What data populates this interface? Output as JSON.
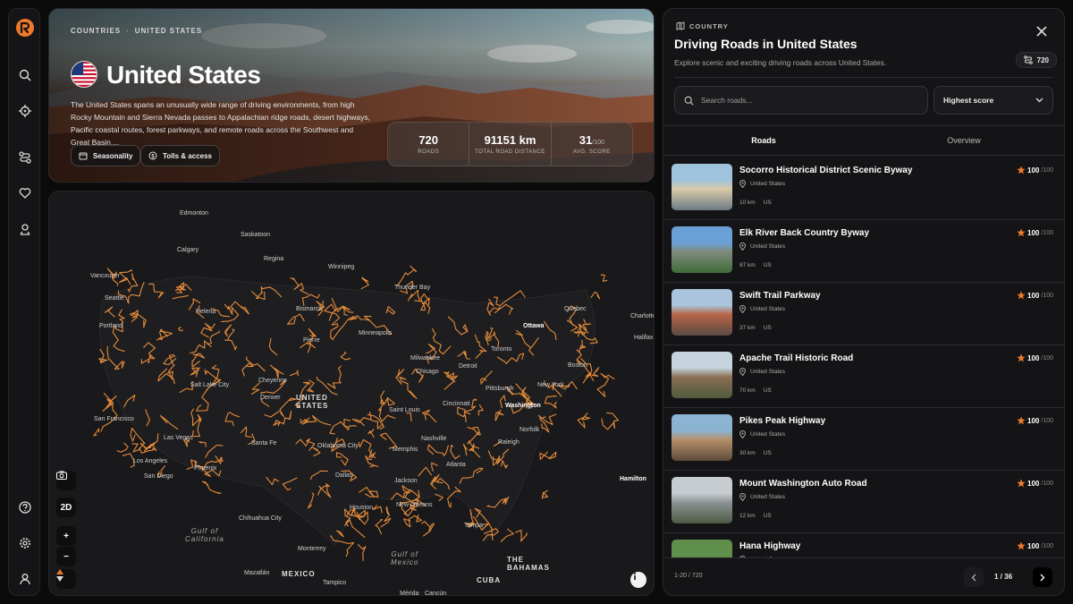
{
  "nav": {
    "items": [
      "search-icon",
      "target-icon",
      "routes-icon",
      "heart-icon",
      "profile-location-icon"
    ],
    "bottom": [
      "help-icon",
      "gear-icon",
      "user-icon"
    ]
  },
  "hero": {
    "breadcrumb": [
      "COUNTRIES",
      "UNITED STATES"
    ],
    "title": "United States",
    "description": "The United States spans an unusually wide range of driving environments, from high Rocky Mountain and Sierra Nevada passes to Appalachian ridge roads, desert highways, Pacific coastal routes, forest parkways, and remote roads across the Southwest and Great Basin....",
    "chips": [
      "Seasonality",
      "Tolls & access"
    ],
    "stats": [
      {
        "value": "720",
        "suffix": "",
        "label": "ROADS"
      },
      {
        "value": "91151 km",
        "suffix": "",
        "label": "TOTAL ROAD DISTANCE"
      },
      {
        "value": "31",
        "suffix": "/100",
        "label": "AVG. SCORE"
      }
    ]
  },
  "map": {
    "labels": {
      "edmonton": "Edmonton",
      "saskatoon": "Saskatoon",
      "calgary": "Calgary",
      "regina": "Regina",
      "winnipeg": "Winnipeg",
      "thunder_bay": "Thunder Bay",
      "vancouver": "Vancouver",
      "seattle": "Seattle",
      "helena": "Helena",
      "bismarck": "Bismarck",
      "quebec": "Quebec",
      "ottawa": "Ottawa",
      "charlotte": "Charlotte",
      "halifax": "Halifax",
      "portland": "Portland",
      "minneapolis": "Minneapolis",
      "pierre": "Pierre",
      "toronto": "Toronto",
      "milwaukee": "Milwaukee",
      "boston": "Boston",
      "detroit": "Detroit",
      "chicago": "Chicago",
      "cheyenne": "Cheyenne",
      "salt_lake": "Salt Lake City",
      "denver": "Denver",
      "pittsburgh": "Pittsburgh",
      "new_york": "New York",
      "united_states": "UNITED\nSTATES",
      "cincinnati": "Cincinnati",
      "washington": "Washington",
      "san_francisco": "San Francisco",
      "saint_louis": "Saint Louis",
      "las_vegas": "Las Vegas",
      "nashville": "Nashville",
      "norfolk": "Norfolk",
      "santa_fe": "Santa Fe",
      "oklahoma": "Oklahoma City",
      "memphis": "Memphis",
      "raleigh": "Raleigh",
      "los_angeles": "Los Angeles",
      "phoenix": "Phoenix",
      "atlanta": "Atlanta",
      "san_diego": "San Diego",
      "dallas": "Dallas",
      "jackson": "Jackson",
      "hamilton": "Hamilton",
      "houston": "Houston",
      "new_orleans": "New Orleans",
      "chihuahua": "Chihuahua City",
      "tampa": "Tampa",
      "gulf_california": "Gulf of\nCalifornia",
      "monterrey": "Monterrey",
      "gulf_mexico": "Gulf of\nMexico",
      "the_bahamas": "THE\nBAHAMAS",
      "mazatlan": "Mazatlán",
      "mexico": "MEXICO",
      "cuba": "CUBA",
      "tampico": "Tampico",
      "merida": "Mérida",
      "cancun": "Cancún"
    },
    "controls": {
      "mode": "2D",
      "plus": "+",
      "minus": "−"
    }
  },
  "panel": {
    "kicker": "COUNTRY",
    "title": "Driving Roads in United States",
    "subtitle": "Explore scenic and exciting driving roads across United States.",
    "count": "720",
    "search_placeholder": "Search roads...",
    "sort_value": "Highest score",
    "tabs": [
      "Roads",
      "Overview"
    ],
    "roads": [
      {
        "name": "Socorro Historical District Scenic Byway",
        "country": "United States",
        "distance": "10 km",
        "code": "US",
        "score": "100",
        "max": "/100",
        "colors": [
          "#9fc3dc",
          "#d8c9a8",
          "#6b7a84"
        ]
      },
      {
        "name": "Elk River Back Country Byway",
        "country": "United States",
        "distance": "87 km",
        "code": "US",
        "score": "100",
        "max": "/100",
        "colors": [
          "#6aa0d6",
          "#7f8b7c",
          "#3f6b3a"
        ]
      },
      {
        "name": "Swift Trail Parkway",
        "country": "United States",
        "distance": "37 km",
        "code": "US",
        "score": "100",
        "max": "/100",
        "colors": [
          "#a9c4dc",
          "#b76445",
          "#5a4a45"
        ]
      },
      {
        "name": "Apache Trail Historic Road",
        "country": "United States",
        "distance": "70 km",
        "code": "US",
        "score": "100",
        "max": "/100",
        "colors": [
          "#c4d3dc",
          "#8a6d52",
          "#4e5b3d"
        ]
      },
      {
        "name": "Pikes Peak Highway",
        "country": "United States",
        "distance": "30 km",
        "code": "US",
        "score": "100",
        "max": "/100",
        "colors": [
          "#8ab4d2",
          "#b68e6a",
          "#5c4a3a"
        ]
      },
      {
        "name": "Mount Washington Auto Road",
        "country": "United States",
        "distance": "12 km",
        "code": "US",
        "score": "100",
        "max": "/100",
        "colors": [
          "#c7ccd0",
          "#8d9294",
          "#4b5a43"
        ]
      },
      {
        "name": "Hana Highway",
        "country": "United States",
        "distance": "",
        "code": "",
        "score": "100",
        "max": "/100",
        "colors": [
          "#5f8f4a",
          "#3d6a34",
          "#2a4a26"
        ]
      }
    ],
    "footer": {
      "range": "1-20 / 720",
      "page": "1 / 36"
    }
  },
  "colors": {
    "accent": "#f07a2a",
    "road": "#f0913c"
  }
}
